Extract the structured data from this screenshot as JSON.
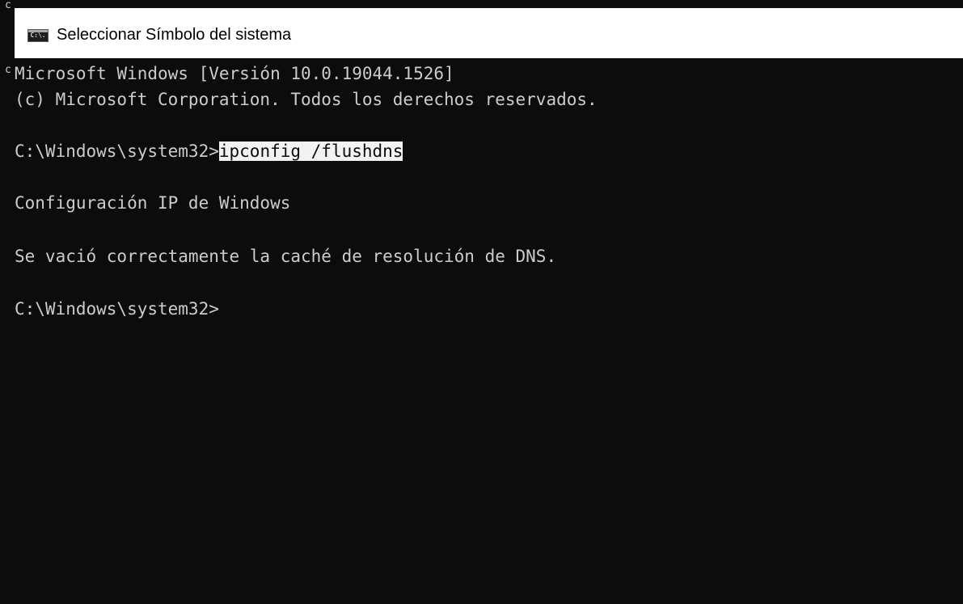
{
  "window": {
    "title": "Seleccionar Símbolo del sistema",
    "icon": "cmd-icon",
    "icon_label": "C:\\."
  },
  "console": {
    "lines": [
      "Microsoft Windows [Versión 10.0.19044.1526]",
      "(c) Microsoft Corporation. Todos los derechos reservados.",
      "",
      "",
      "",
      "Configuración IP de Windows",
      "",
      "Se vació correctamente la caché de resolución de DNS.",
      "",
      "C:\\Windows\\system32>"
    ],
    "command_prompt": "C:\\Windows\\system32>",
    "command_selected": "ipconfig /flushdns"
  },
  "stray_chars": {
    "top": "c",
    "left": "c"
  },
  "colors": {
    "background": "#0c0c0c",
    "text": "#cccccc",
    "selection_bg": "#f2f2f2",
    "titlebar_bg": "#ffffff"
  }
}
